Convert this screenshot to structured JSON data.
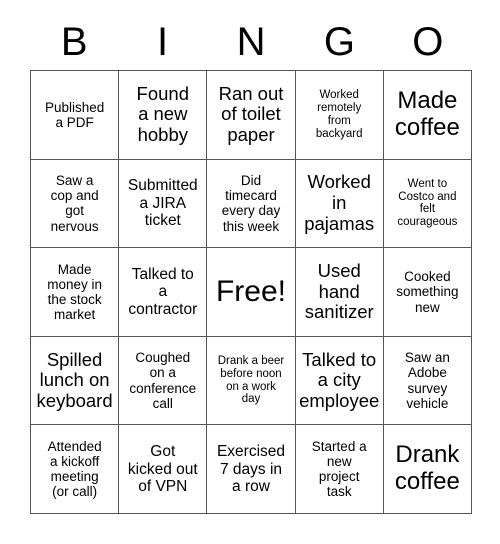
{
  "card": {
    "title": "BINGO",
    "header_letters": [
      "B",
      "I",
      "N",
      "G",
      "O"
    ],
    "border_color": "#555555",
    "background_color": "#ffffff",
    "text_color": "#000000",
    "rows": 5,
    "columns": 5,
    "cells": [
      {
        "text": "Published\na PDF",
        "size": "sz-s",
        "free": false
      },
      {
        "text": "Found\na new\nhobby",
        "size": "sz-l",
        "free": false
      },
      {
        "text": "Ran out\nof toilet\npaper",
        "size": "sz-l",
        "free": false
      },
      {
        "text": "Worked\nremotely\nfrom\nbackyard",
        "size": "sz-xs",
        "free": false
      },
      {
        "text": "Made\ncoffee",
        "size": "sz-xl",
        "free": false
      },
      {
        "text": "Saw a\ncop and\ngot\nnervous",
        "size": "sz-s",
        "free": false
      },
      {
        "text": "Submitted\na JIRA\nticket",
        "size": "sz-m",
        "free": false
      },
      {
        "text": "Did\ntimecard\nevery day\nthis week",
        "size": "sz-s",
        "free": false
      },
      {
        "text": "Worked\nin\npajamas",
        "size": "sz-l",
        "free": false
      },
      {
        "text": "Went to\nCostco and\nfelt\ncourageous",
        "size": "sz-xs",
        "free": false
      },
      {
        "text": "Made\nmoney in\nthe stock\nmarket",
        "size": "sz-s",
        "free": false
      },
      {
        "text": "Talked to\na\ncontractor",
        "size": "sz-m",
        "free": false
      },
      {
        "text": "Free!",
        "size": "sz-xxl",
        "free": true
      },
      {
        "text": "Used\nhand\nsanitizer",
        "size": "sz-l",
        "free": false
      },
      {
        "text": "Cooked\nsomething\nnew",
        "size": "sz-s",
        "free": false
      },
      {
        "text": "Spilled\nlunch on\nkeyboard",
        "size": "sz-l",
        "free": false
      },
      {
        "text": "Coughed\non a\nconference\ncall",
        "size": "sz-s",
        "free": false
      },
      {
        "text": "Drank a beer\nbefore noon\non a work\nday",
        "size": "sz-xs",
        "free": false
      },
      {
        "text": "Talked to\na city\nemployee",
        "size": "sz-l",
        "free": false
      },
      {
        "text": "Saw an\nAdobe\nsurvey\nvehicle",
        "size": "sz-s",
        "free": false
      },
      {
        "text": "Attended\na kickoff\nmeeting\n(or call)",
        "size": "sz-s",
        "free": false
      },
      {
        "text": "Got\nkicked out\nof VPN",
        "size": "sz-m",
        "free": false
      },
      {
        "text": "Exercised\n7 days in\na row",
        "size": "sz-m",
        "free": false
      },
      {
        "text": "Started a\nnew\nproject\ntask",
        "size": "sz-s",
        "free": false
      },
      {
        "text": "Drank\ncoffee",
        "size": "sz-xl",
        "free": false
      }
    ]
  }
}
